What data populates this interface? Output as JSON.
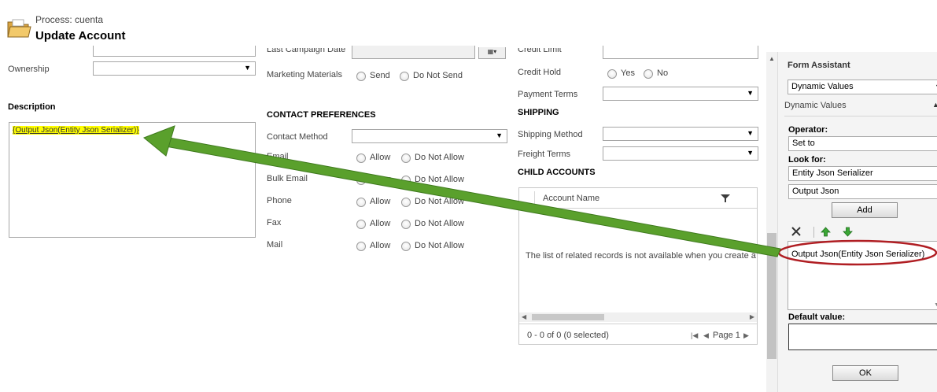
{
  "header": {
    "process_label": "Process: cuenta",
    "title": "Update Account"
  },
  "left": {
    "ownership_label": "Ownership",
    "description_label": "Description",
    "description_value": "{Output Json(Entity Json Serializer)}"
  },
  "middle": {
    "last_campaign_label": "Last Campaign Date",
    "marketing_label": "Marketing Materials",
    "marketing_options": [
      "Send",
      "Do Not Send"
    ],
    "contact_pref_heading": "CONTACT PREFERENCES",
    "contact_method_label": "Contact Method",
    "prefs": [
      {
        "label": "Email",
        "allow": "Allow",
        "deny": "Do Not Allow"
      },
      {
        "label": "Bulk Email",
        "allow": "Allow",
        "deny": "Do Not Allow"
      },
      {
        "label": "Phone",
        "allow": "Allow",
        "deny": "Do Not Allow"
      },
      {
        "label": "Fax",
        "allow": "Allow",
        "deny": "Do Not Allow"
      },
      {
        "label": "Mail",
        "allow": "Allow",
        "deny": "Do Not Allow"
      }
    ]
  },
  "right": {
    "credit_limit_label": "Credit Limit",
    "credit_hold_label": "Credit Hold",
    "credit_hold_options": [
      "Yes",
      "No"
    ],
    "payment_terms_label": "Payment Terms",
    "shipping_heading": "SHIPPING",
    "shipping_method_label": "Shipping Method",
    "freight_terms_label": "Freight Terms",
    "child_heading": "CHILD ACCOUNTS",
    "grid_column": "Account Name",
    "grid_empty": "The list of related records is not available when you create a",
    "grid_status": "0 - 0 of 0 (0 selected)",
    "grid_page": "Page 1"
  },
  "assistant": {
    "title": "Form Assistant",
    "top_select": "Dynamic Values",
    "section_title": "Dynamic Values",
    "operator_label": "Operator:",
    "operator_value": "Set to",
    "lookfor_label": "Look for:",
    "lookfor_entity": "Entity Json Serializer",
    "lookfor_field": "Output Json",
    "add_label": "Add",
    "list_item": "Output Json(Entity Json Serializer)",
    "default_label": "Default value:",
    "ok_label": "OK"
  },
  "colors": {
    "highlight": "#ffff00",
    "arrow": "#5aa02c",
    "circle": "#b01e23",
    "up_arrow": "#3aa635",
    "down_arrow": "#3aa635"
  }
}
